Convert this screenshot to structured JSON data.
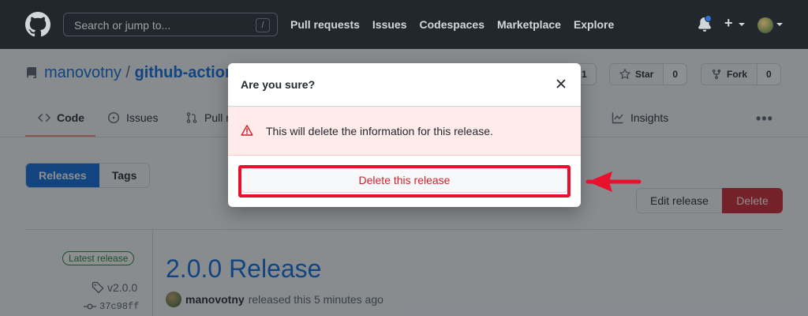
{
  "header": {
    "search_placeholder": "Search or jump to...",
    "search_shortcut": "/",
    "nav": [
      "Pull requests",
      "Issues",
      "Codespaces",
      "Marketplace",
      "Explore"
    ],
    "plus_symbol": "+"
  },
  "repo": {
    "owner": "manovotny",
    "separator": "/",
    "name": "github-action",
    "watch_count": "1",
    "star_label": "Star",
    "star_count": "0",
    "fork_label": "Fork",
    "fork_count": "0"
  },
  "tabs": {
    "code": "Code",
    "issues": "Issues",
    "pulls": "Pull r",
    "insights": "Insights",
    "more": "•••"
  },
  "releases": {
    "seg_releases": "Releases",
    "seg_tags": "Tags",
    "edit_label": "Edit release",
    "delete_label": "Delete",
    "latest_badge": "Latest release",
    "tag": "v2.0.0",
    "commit": "37c98ff",
    "title": "2.0.0 Release",
    "author": "manovotny",
    "released_text": "released this 5 minutes ago"
  },
  "modal": {
    "title": "Are you sure?",
    "warning": "This will delete the information for this release.",
    "confirm_label": "Delete this release"
  },
  "colors": {
    "header_bg": "#24292f",
    "link": "#0969da",
    "danger": "#cf222e",
    "annotation": "#e8112d",
    "flash_bg": "#ffebe9"
  }
}
